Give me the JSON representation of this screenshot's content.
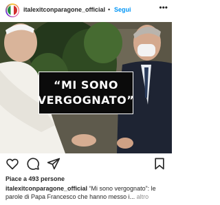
{
  "header": {
    "username": "italexitconparagone_official",
    "separator": "•",
    "follow_label": "Segui",
    "more_icon": "ellipsis-icon"
  },
  "post": {
    "overlay_line1": "“MI SONO",
    "overlay_line2": "VERGOGNATO”"
  },
  "actions": {
    "like_icon": "heart-icon",
    "comment_icon": "comment-icon",
    "share_icon": "send-icon",
    "save_icon": "bookmark-icon"
  },
  "likes_text": "Piace a 493 persone",
  "caption": {
    "user": "italexitconparagone_official",
    "text": " “Mi sono vergognato”: le parole di Papa Francesco che hanno messo i...",
    "more_label": " altro"
  },
  "colors": {
    "accent": "#0095f6",
    "text": "#262626",
    "secondary": "#8e8e8e"
  }
}
